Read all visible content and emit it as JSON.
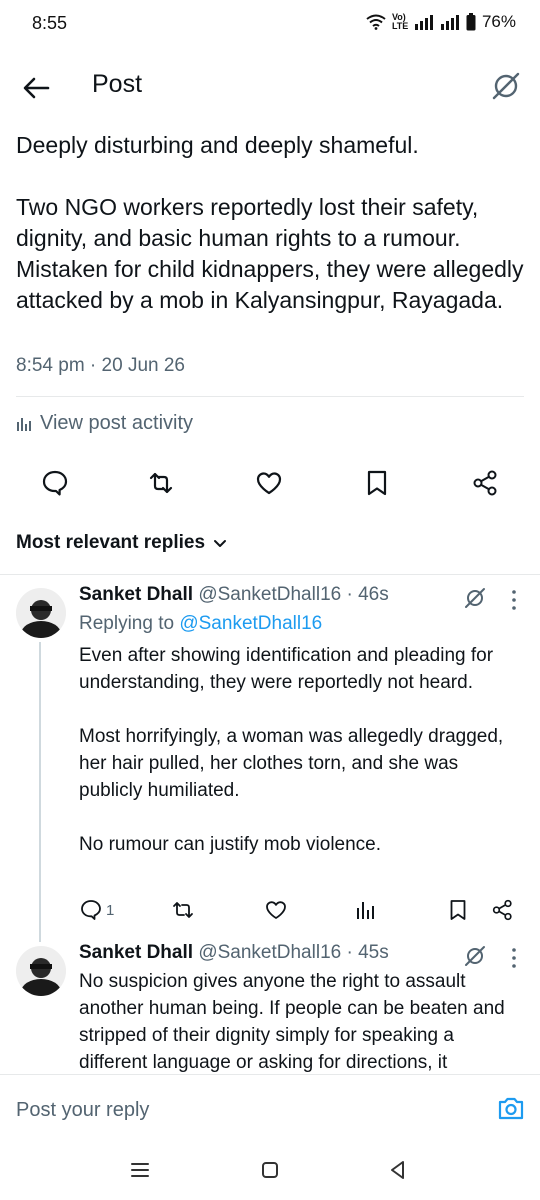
{
  "status_bar": {
    "time": "8:55",
    "network_label": "Vo) LTE",
    "battery": "76%"
  },
  "header": {
    "title": "Post"
  },
  "post": {
    "text": "Deeply disturbing and deeply shameful.\n\nTwo NGO workers reportedly lost their safety, dignity, and basic human rights to a rumour. Mistaken for child kidnappers, they were allegedly attacked by a mob in Kalyansingpur, Rayagada.",
    "timestamp": "8:54 pm · 20 Jun 26",
    "activity_label": "View post activity"
  },
  "replies_sort": {
    "label": "Most relevant replies"
  },
  "replies": [
    {
      "name": "Sanket Dhall",
      "handle": "@SanketDhall16 · 46s",
      "replying_prefix": "Replying to ",
      "replying_to": "@SanketDhall16",
      "text": "Even after showing identification and pleading for understanding, they were reportedly not heard.\n\nMost horrifyingly, a woman was allegedly dragged, her hair pulled, her clothes torn, and she was publicly humiliated.\n\nNo rumour can justify mob violence.",
      "reply_count": "1"
    },
    {
      "name": "Sanket Dhall",
      "handle": "@SanketDhall16 · 45s",
      "text": "No suspicion gives anyone the right to assault another human being. If people can be beaten and stripped of their dignity simply for speaking a different language or asking for directions, it"
    }
  ],
  "compose": {
    "placeholder": "Post your reply"
  },
  "colors": {
    "accent": "#1d9bf0",
    "text": "#0f1419",
    "muted": "#536471",
    "divider": "#e7e9ea"
  },
  "icons": [
    "back-arrow-icon",
    "grok-icon",
    "bar-chart-icon",
    "comment-icon",
    "repost-icon",
    "like-icon",
    "bookmark-icon",
    "share-icon",
    "chevron-down-icon",
    "more-icon",
    "camera-icon",
    "recents-icon",
    "home-icon",
    "back-nav-icon"
  ]
}
